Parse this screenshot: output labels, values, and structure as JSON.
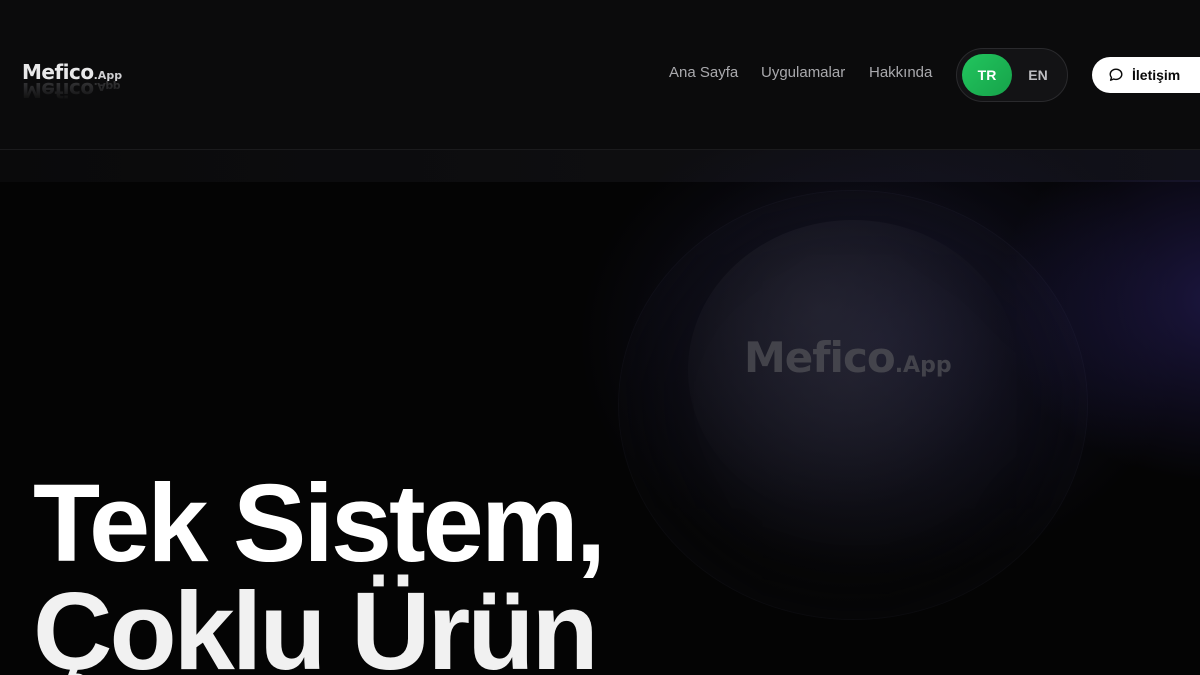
{
  "brand": {
    "name": "Mefico",
    "suffix": ".App"
  },
  "nav": {
    "items": [
      {
        "label": "Ana Sayfa"
      },
      {
        "label": "Uygulamalar"
      },
      {
        "label": "Hakkında"
      }
    ]
  },
  "language": {
    "options": [
      "TR",
      "EN"
    ],
    "selected": "TR"
  },
  "contact_button": {
    "label": "İletişim",
    "icon": "chat-bubble-icon"
  },
  "hero": {
    "logo_name": "Mefico",
    "logo_suffix": ".App",
    "headline_line1": "Tek Sistem,",
    "headline_line2": "Çoklu Ürün"
  },
  "colors": {
    "background": "#050505",
    "accent_green": "#22c55e",
    "accent_purple": "#2e246e",
    "text_primary": "#ffffff",
    "text_muted": "#a9a9ad"
  }
}
